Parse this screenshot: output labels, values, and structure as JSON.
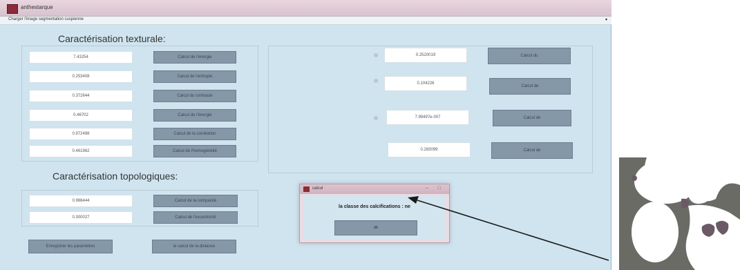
{
  "window": {
    "title": "anthestarque"
  },
  "menubar": {
    "items": "Charger l'image  segmentation  cuspienne"
  },
  "textural": {
    "title": "Caractérisation texturale:",
    "rows": [
      {
        "value": "7.43254",
        "button": "Calcul de l'énergie"
      },
      {
        "value": "0.253408",
        "button": "Calcul de l'entropie"
      },
      {
        "value": "0.372644",
        "button": "Calcul du contraste"
      },
      {
        "value": "0.46702",
        "button": "Calcul de l'énergie"
      },
      {
        "value": "0.972498",
        "button": "Calcul de la corrélation"
      },
      {
        "value": "0.461962",
        "button": "Calcul de l'homogénéité"
      }
    ]
  },
  "right_rows": [
    {
      "value": "0.2520019",
      "button": "Calcul du"
    },
    {
      "value": "0.104226",
      "button": "Calcul de"
    },
    {
      "value": "7.99497e-007",
      "button": "Calcul de"
    },
    {
      "value": "0.283099",
      "button": "Calcul de"
    }
  ],
  "topological": {
    "title": "Caractérisation topologiques:",
    "rows": [
      {
        "value": "0.966444",
        "button": "Calcul de la compacité"
      },
      {
        "value": "0.300027",
        "button": "Calcul de l'excentricité"
      }
    ]
  },
  "bottom_buttons": {
    "left": "Enregistrer les paramètres",
    "right": "le calcul de la distance"
  },
  "dialog": {
    "title": "calcul",
    "message": "la classe des calcifications :",
    "message_end": "ne",
    "ok": "ok"
  }
}
